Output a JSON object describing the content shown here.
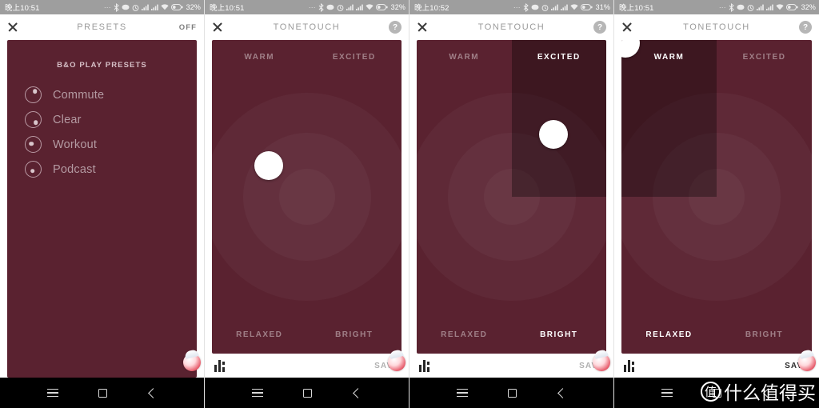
{
  "panels": [
    {
      "status": {
        "time": "晚上10:51",
        "battery": "32%",
        "icons": [
          "dots-icon",
          "bluetooth-icon",
          "sync-icon",
          "alarm-icon",
          "signal-icon",
          "signal-icon",
          "wifi-icon",
          "battery-icon"
        ]
      },
      "appbar": {
        "title": "PRESETS",
        "right_label": "OFF",
        "close": "close-icon"
      },
      "presets": {
        "heading": "B&O PLAY PRESETS",
        "items": [
          {
            "label": "Commute",
            "dot_x": "62%",
            "dot_y": "28%"
          },
          {
            "label": "Clear",
            "dot_x": "66%",
            "dot_y": "68%"
          },
          {
            "label": "Workout",
            "dot_x": "38%",
            "dot_y": "46%"
          },
          {
            "label": "Podcast",
            "dot_x": "46%",
            "dot_y": "62%"
          }
        ]
      }
    },
    {
      "status": {
        "time": "晚上10:51",
        "battery": "32%"
      },
      "appbar": {
        "title": "TONETOUCH",
        "help": "?",
        "close": "close-icon"
      },
      "pad": {
        "labels": {
          "tl": "WARM",
          "tr": "EXCITED",
          "bl": "RELAXED",
          "br": "BRIGHT"
        },
        "selected": "none",
        "bright_labels": [],
        "handle": {
          "x": "30%",
          "y": "40%"
        }
      },
      "savebar": {
        "eq_icon": "equalizer-icon",
        "save_label": "SAVE",
        "save_active": false
      }
    },
    {
      "status": {
        "time": "晚上10:52",
        "battery": "31%"
      },
      "appbar": {
        "title": "TONETOUCH",
        "help": "?",
        "close": "close-icon"
      },
      "pad": {
        "labels": {
          "tl": "WARM",
          "tr": "EXCITED",
          "bl": "RELAXED",
          "br": "BRIGHT"
        },
        "selected": "tr",
        "bright_labels": [
          "tr",
          "br"
        ],
        "handle": {
          "x": "72%",
          "y": "30%"
        }
      },
      "savebar": {
        "eq_icon": "equalizer-icon",
        "save_label": "SAVE",
        "save_active": false
      }
    },
    {
      "status": {
        "time": "晚上10:51",
        "battery": "32%"
      },
      "appbar": {
        "title": "TONETOUCH",
        "help": "?",
        "close": "close-icon"
      },
      "pad": {
        "labels": {
          "tl": "WARM",
          "tr": "EXCITED",
          "bl": "RELAXED",
          "br": "BRIGHT"
        },
        "selected": "tl",
        "bright_labels": [
          "tl",
          "bl"
        ],
        "handle": {
          "x": "2%",
          "y": "1%"
        }
      },
      "savebar": {
        "eq_icon": "equalizer-icon",
        "save_label": "SAVE",
        "save_active": true
      }
    }
  ],
  "navbar": {
    "menu": "menu-icon",
    "home": "home-icon",
    "back": "back-icon"
  },
  "watermark": {
    "mark": "值",
    "text": "什么值得买"
  }
}
